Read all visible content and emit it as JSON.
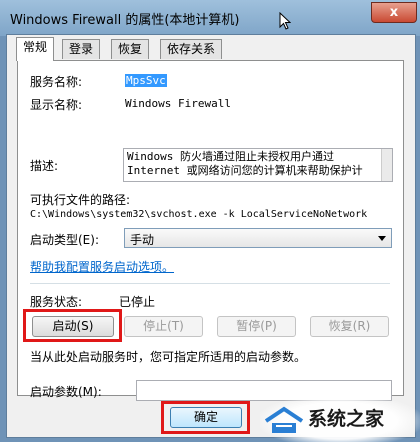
{
  "window": {
    "title": "Windows Firewall 的属性(本地计算机)",
    "close_label": "x"
  },
  "tabs": [
    {
      "label": "常规"
    },
    {
      "label": "登录"
    },
    {
      "label": "恢复"
    },
    {
      "label": "依存关系"
    }
  ],
  "general": {
    "service_name_label": "服务名称:",
    "service_name_value": "MpsSvc",
    "display_name_label": "显示名称:",
    "display_name_value": "Windows Firewall",
    "description_label": "描述:",
    "description_line1": "Windows 防火墙通过阻止未授权用户通过",
    "description_line2": "Internet 或网络访问您的计算机来帮助保护计",
    "exe_path_label": "可执行文件的路径:",
    "exe_path_value": "C:\\Windows\\system32\\svchost.exe -k LocalServiceNoNetwork",
    "startup_type_label": "启动类型(E):",
    "startup_type_value": "手动",
    "help_link": "帮助我配置服务启动选项。",
    "status_label": "服务状态:",
    "status_value": "已停止",
    "start_button": "启动(S)",
    "stop_button": "停止(T)",
    "pause_button": "暂停(P)",
    "resume_button": "恢复(R)",
    "hint_text": "当从此处启动服务时，您可指定所适用的启动参数。",
    "start_params_label": "启动参数(M):",
    "start_params_value": ""
  },
  "footer": {
    "ok_button": "确定"
  },
  "watermark": {
    "text": "系统之家"
  }
}
